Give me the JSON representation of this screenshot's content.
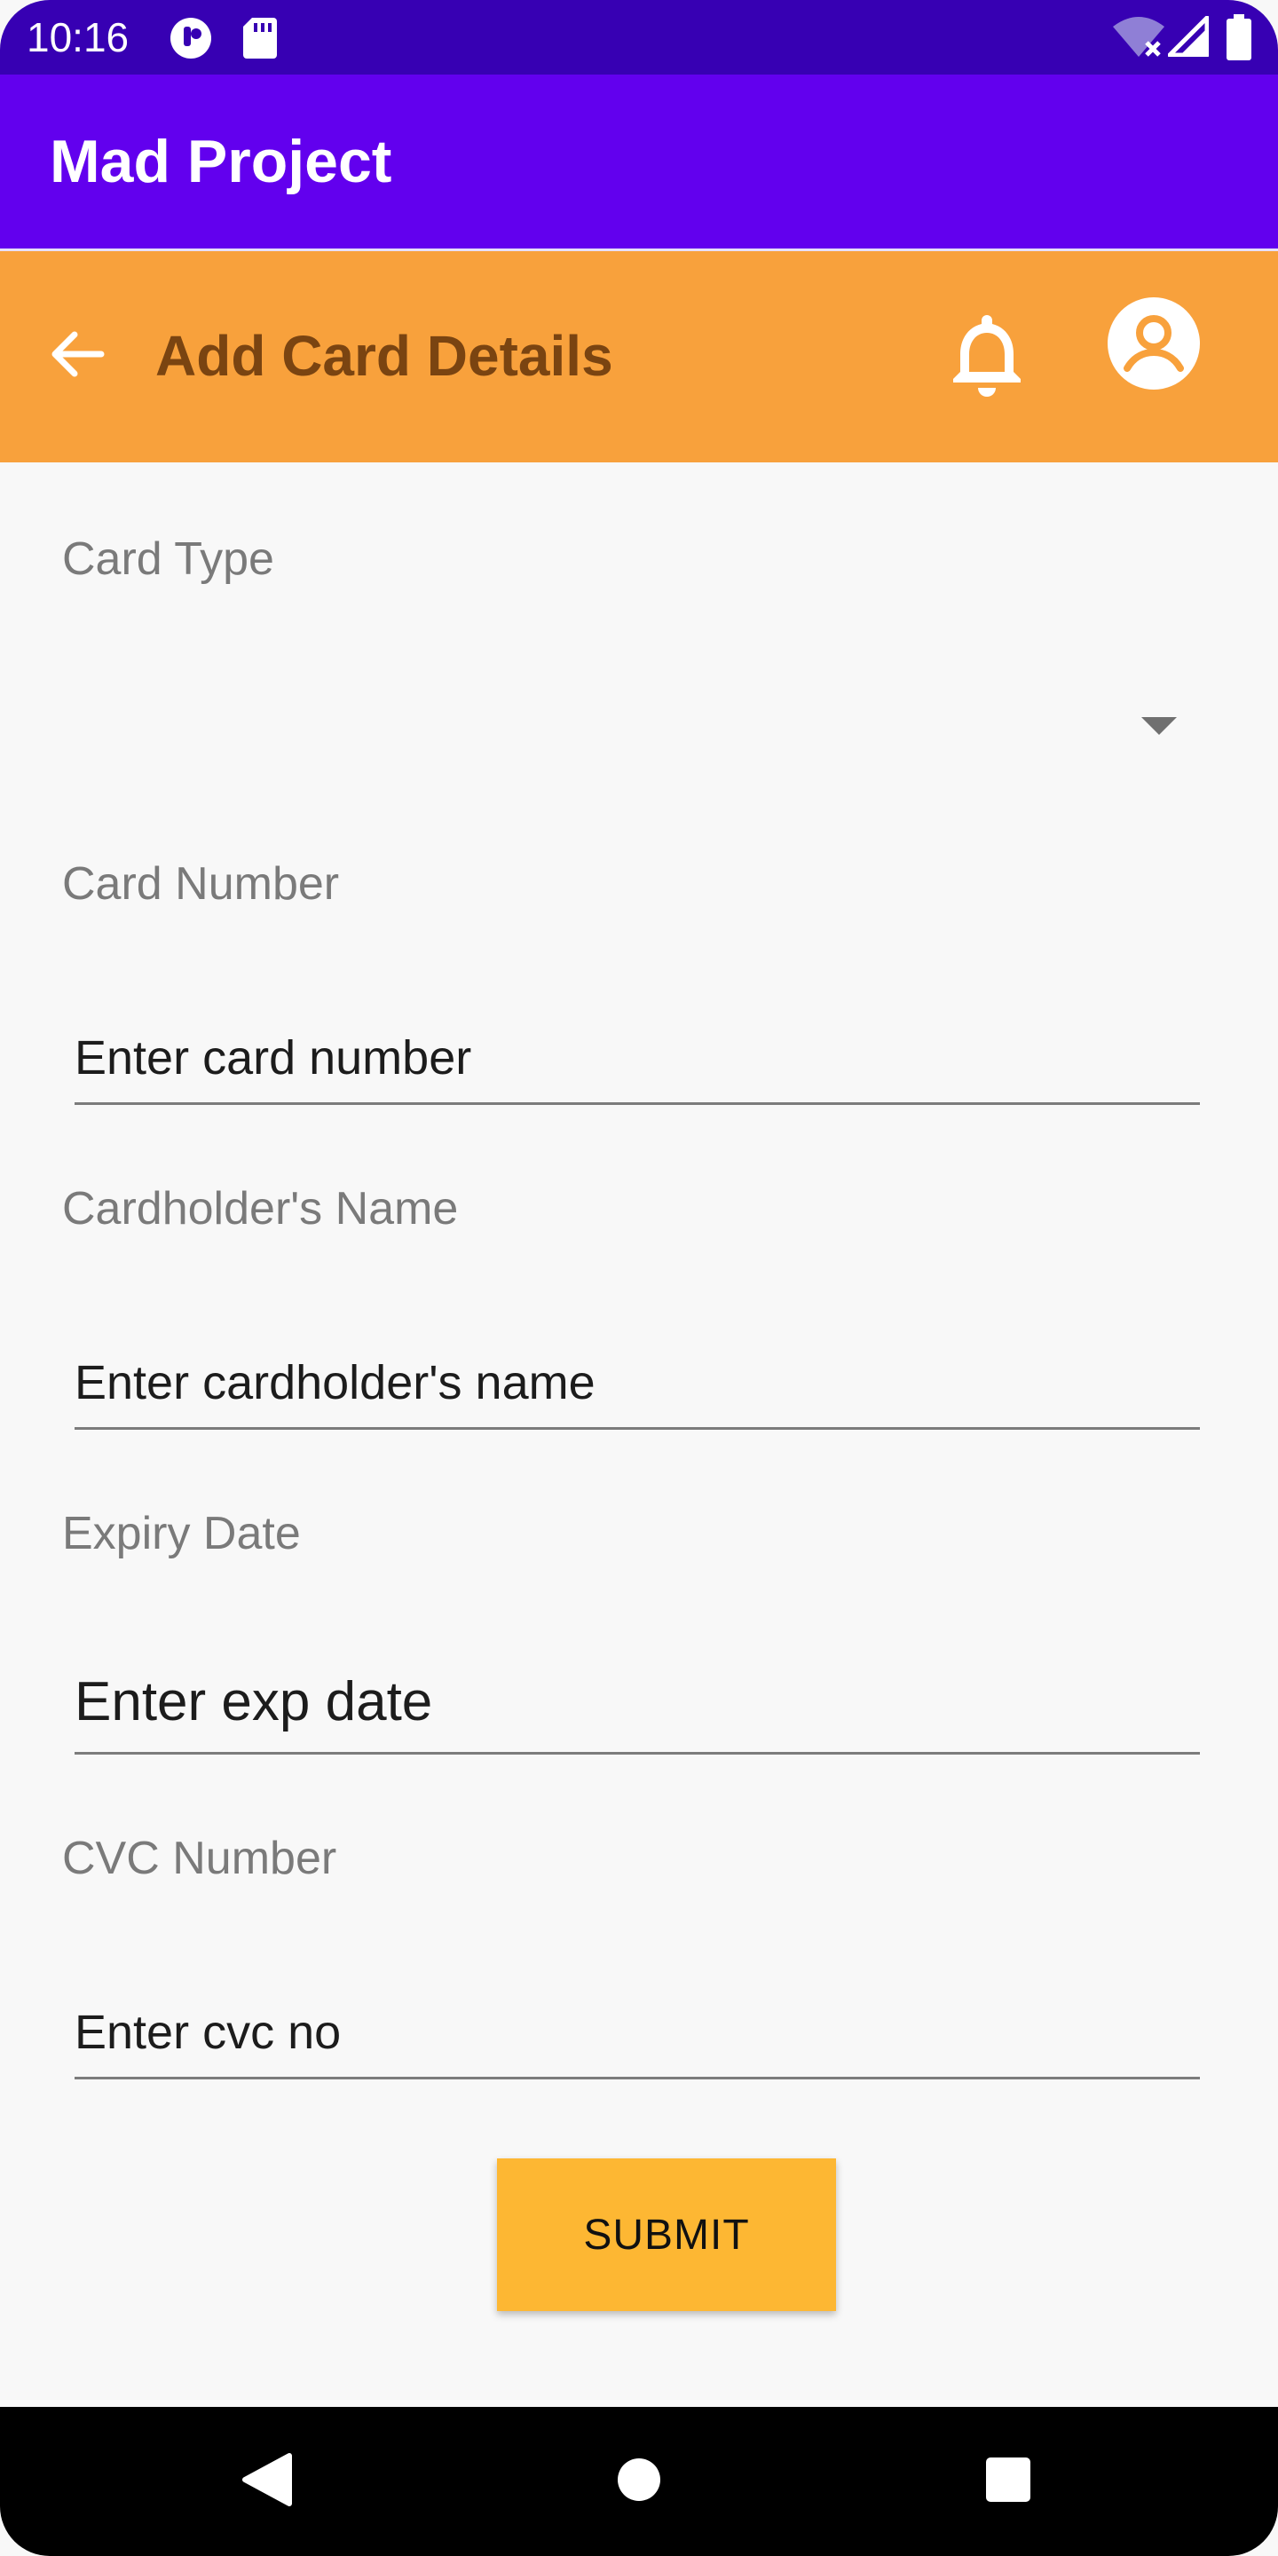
{
  "status_bar": {
    "time": "10:16",
    "icons": [
      "app-notification-icon",
      "sd-card-icon",
      "wifi-off-icon",
      "signal-icon",
      "battery-icon"
    ]
  },
  "app_bar": {
    "title": "Mad Project",
    "color": "#6200ee"
  },
  "header": {
    "title": "Add Card Details",
    "back_icon": "arrow-back-icon",
    "notification_icon": "bell-icon",
    "profile_icon": "account-circle-icon",
    "color": "#f8a13c"
  },
  "form": {
    "card_type": {
      "label": "Card Type",
      "value": ""
    },
    "card_number": {
      "label": "Card Number",
      "placeholder": "Enter card number"
    },
    "cardholder_name": {
      "label": "Cardholder's Name",
      "placeholder": "Enter cardholder's name"
    },
    "expiry_date": {
      "label": "Expiry Date",
      "placeholder": "Enter exp date"
    },
    "cvc_number": {
      "label": "CVC Number",
      "placeholder": "Enter cvc no"
    },
    "submit_label": "SUBMIT",
    "submit_color": "#fdb733"
  },
  "nav_bar": {
    "back": "triangle-back-icon",
    "home": "circle-home-icon",
    "recents": "square-recents-icon"
  }
}
